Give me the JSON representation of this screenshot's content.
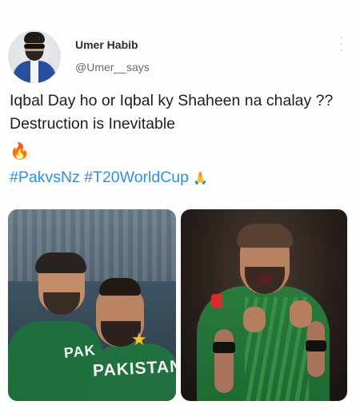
{
  "author": {
    "name": "Umer Habib",
    "handle": "@Umer__says"
  },
  "tweet": {
    "text": "Iqbal Day ho or Iqbal ky Shaheen na chalay ?? Destruction is Inevitable",
    "emoji_fire": "🔥",
    "hashtags": "#PakvsNz #T20WorldCup",
    "emoji_pray": "🙏"
  },
  "media": {
    "left_jersey_text_1": "PAK",
    "left_jersey_text_2": "PAKISTAN",
    "colors": {
      "hashtag": "#2f8fe0",
      "jersey_green": "#1f6e3d"
    }
  },
  "icons": {
    "more": "more-vertical-icon"
  }
}
